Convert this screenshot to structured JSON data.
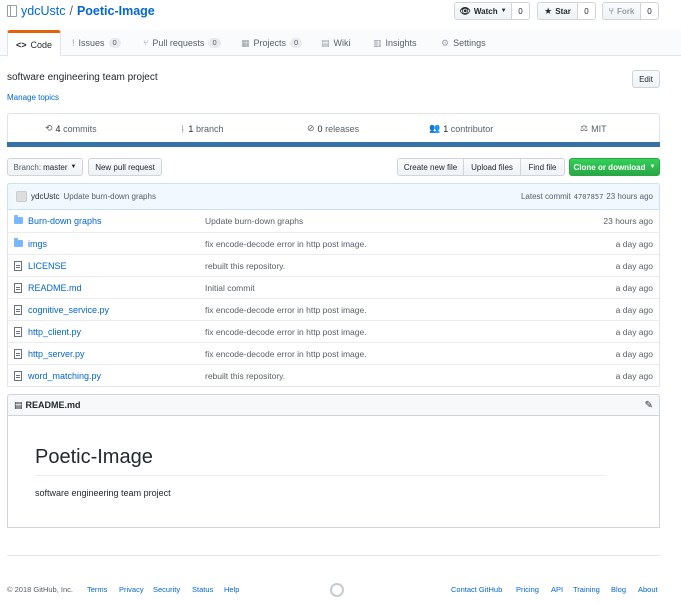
{
  "repo": {
    "owner": "ydcUstc",
    "separator": "/",
    "name": "Poetic-Image"
  },
  "actions": {
    "watch": {
      "label": "Watch",
      "count": "0"
    },
    "star": {
      "label": "Star",
      "count": "0"
    },
    "fork": {
      "label": "Fork",
      "count": "0"
    }
  },
  "tabs": [
    {
      "label": "Code",
      "icon": "<>",
      "count": ""
    },
    {
      "label": "Issues",
      "icon": "!",
      "count": "0"
    },
    {
      "label": "Pull requests",
      "icon": "⑂",
      "count": "0"
    },
    {
      "label": "Projects",
      "icon": "▦",
      "count": "0"
    },
    {
      "label": "Wiki",
      "icon": "▤",
      "count": ""
    },
    {
      "label": "Insights",
      "icon": "▥",
      "count": ""
    },
    {
      "label": "Settings",
      "icon": "⚙",
      "count": ""
    }
  ],
  "description": "software engineering team project",
  "manage_topics": "Manage topics",
  "edit_label": "Edit",
  "summary": {
    "commits": {
      "num": "4",
      "label": "commits"
    },
    "branch": {
      "num": "1",
      "label": "branch"
    },
    "releases": {
      "num": "0",
      "label": "releases"
    },
    "contributor": {
      "num": "1",
      "label": "contributor"
    },
    "license": "MIT"
  },
  "language_color": "#3572a5",
  "branch_select": {
    "prefix": "Branch:",
    "value": "master"
  },
  "new_pr": "New pull request",
  "file_buttons": {
    "create": "Create new file",
    "upload": "Upload files",
    "find": "Find file",
    "clone": "Clone or download"
  },
  "latest_commit": {
    "author": "ydcUstc",
    "message": "Update burn-down graphs",
    "label": "Latest commit",
    "sha": "4707857",
    "age": "23 hours ago"
  },
  "files": [
    {
      "type": "folder",
      "name": "Burn-down graphs",
      "message": "Update burn-down graphs",
      "age": "23 hours ago"
    },
    {
      "type": "folder",
      "name": "imgs",
      "message": "fix encode-decode error in http post image.",
      "age": "a day ago"
    },
    {
      "type": "file",
      "name": "LICENSE",
      "message": "rebuilt this repository.",
      "age": "a day ago"
    },
    {
      "type": "file",
      "name": "README.md",
      "message": "Initial commit",
      "age": "a day ago"
    },
    {
      "type": "file",
      "name": "cognitive_service.py",
      "message": "fix encode-decode error in http post image.",
      "age": "a day ago"
    },
    {
      "type": "file",
      "name": "http_client.py",
      "message": "fix encode-decode error in http post image.",
      "age": "a day ago"
    },
    {
      "type": "file",
      "name": "http_server.py",
      "message": "fix encode-decode error in http post image.",
      "age": "a day ago"
    },
    {
      "type": "file",
      "name": "word_matching.py",
      "message": "rebuilt this repository.",
      "age": "a day ago"
    }
  ],
  "readme": {
    "filename": "README.md",
    "title": "Poetic-Image",
    "body": "software engineering team project"
  },
  "footer": {
    "copyright": "© 2018 GitHub, Inc.",
    "left_links": [
      "Terms",
      "Privacy",
      "Security",
      "Status",
      "Help"
    ],
    "right_links": [
      "Contact GitHub",
      "Pricing",
      "API",
      "Training",
      "Blog",
      "About"
    ]
  }
}
